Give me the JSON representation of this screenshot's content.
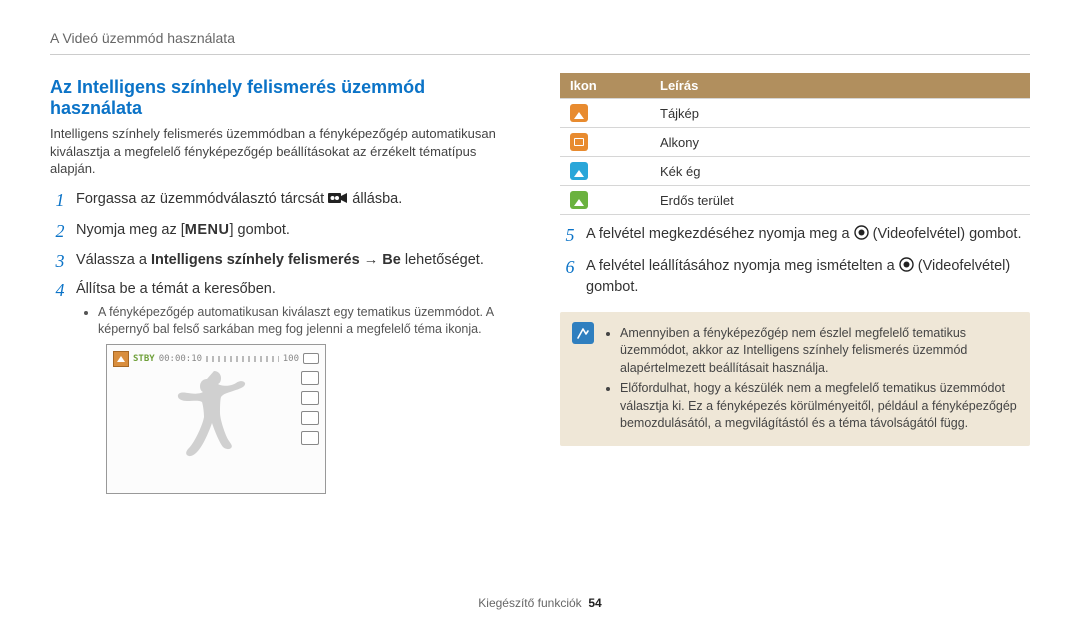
{
  "breadcrumb": "A Videó üzemmód használata",
  "heading": "Az Intelligens színhely felismerés üzemmód használata",
  "intro": "Intelligens színhely felismerés üzemmódban a fényképezőgép automatikusan kiválasztja a megfelelő fényképezőgép beállításokat az érzékelt tématípus alapján.",
  "steps_left": {
    "s1_a": "Forgassa az üzemmódválasztó tárcsát ",
    "s1_b": " állásba.",
    "s2_a": "Nyomja meg az [",
    "s2_menu": "MENU",
    "s2_b": "] gombot.",
    "s3_a": "Válassza a ",
    "s3_bold": "Intelligens színhely felismerés",
    "s3_arrow": " → ",
    "s3_bold2": "Be",
    "s3_b": " lehetőséget.",
    "s4": "Állítsa be a témát a keresőben.",
    "s4_bullet": "A fényképezőgép automatikusan kiválaszt egy tematikus üzemmódot. A képernyő bal felső sarkában meg fog jelenni a megfelelő téma ikonja."
  },
  "preview": {
    "stby": "STBY",
    "time": "00:00:10",
    "count": "100"
  },
  "table": {
    "h1": "Ikon",
    "h2": "Leírás",
    "rows": [
      {
        "label": "Tájkép"
      },
      {
        "label": "Alkony"
      },
      {
        "label": "Kék ég"
      },
      {
        "label": "Erdős terület"
      }
    ]
  },
  "steps_right": {
    "s5_a": "A felvétel megkezdéséhez nyomja meg a ",
    "s5_b": " (Videofelvétel) gombot.",
    "s6_a": "A felvétel leállításához nyomja meg ismételten a ",
    "s6_b": " (Videofelvétel) gombot."
  },
  "notes": [
    "Amennyiben a fényképezőgép nem észlel megfelelő tematikus üzemmódot, akkor az Intelligens színhely felismerés üzemmód alapértelmezett beállításait használja.",
    "Előfordulhat, hogy a készülék nem a megfelelő tematikus üzemmódot választja ki. Ez a fényképezés körülményeitől, például a fényképezőgép bemozdulásától, a megvilágítástól és a téma távolságától függ."
  ],
  "footer": {
    "label": "Kiegészítő funkciók",
    "page": "54"
  }
}
